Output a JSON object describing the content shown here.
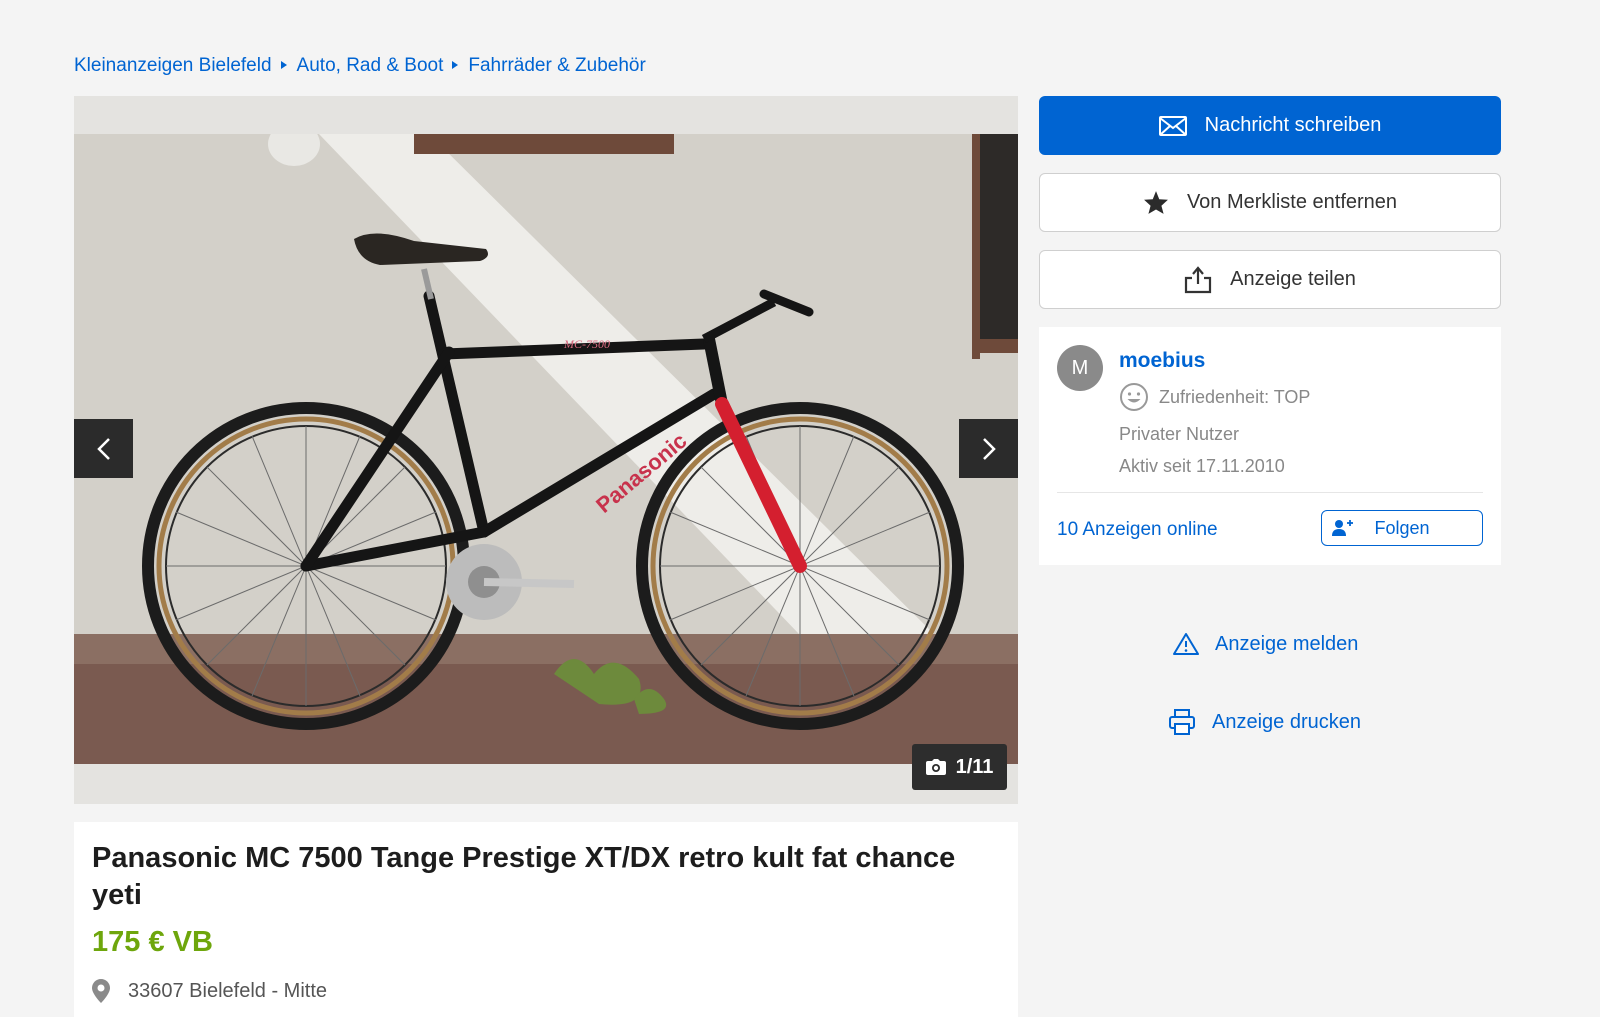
{
  "breadcrumb": {
    "items": [
      "Kleinanzeigen Bielefeld",
      "Auto, Rad & Boot",
      "Fahrräder & Zubehör"
    ]
  },
  "gallery": {
    "counter": "1/11"
  },
  "ad": {
    "title": "Panasonic MC 7500 Tange Prestige XT/DX retro kult fat chance yeti",
    "price": "175 € VB",
    "location": "33607 Bielefeld - Mitte"
  },
  "actions": {
    "message": "Nachricht schreiben",
    "watchlist": "Von Merkliste entfernen",
    "share": "Anzeige teilen"
  },
  "seller": {
    "initial": "M",
    "name": "moebius",
    "rating": "Zufriedenheit: TOP",
    "type": "Privater Nutzer",
    "since": "Aktiv seit 17.11.2010",
    "ads_count": "10 Anzeigen online",
    "follow": "Folgen"
  },
  "links": {
    "report": "Anzeige melden",
    "print": "Anzeige drucken"
  },
  "colors": {
    "primary": "#0064d2",
    "price": "#6ea60c",
    "background": "#f4f4f4"
  },
  "icons": {
    "message": "envelope-icon",
    "watchlist": "star-icon",
    "share": "share-icon",
    "rating": "smiley-icon",
    "follow": "add-user-icon",
    "report": "warning-icon",
    "print": "printer-icon",
    "location": "location-pin-icon",
    "counter": "camera-icon"
  }
}
